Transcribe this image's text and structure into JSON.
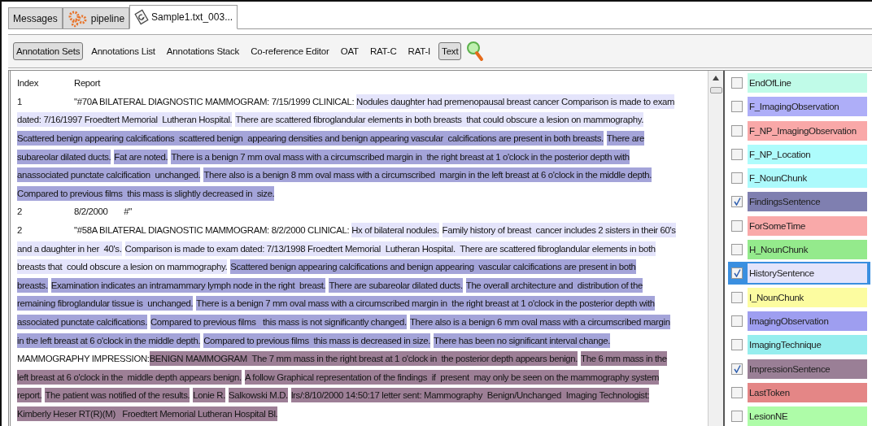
{
  "tabs": [
    {
      "label": "Messages",
      "selected": false
    },
    {
      "label": "pipeline",
      "selected": false
    },
    {
      "label": "Sample1.txt_003...",
      "selected": true
    }
  ],
  "toolbar": [
    {
      "label": "Annotation Sets",
      "selected": true
    },
    {
      "label": "Annotations List",
      "selected": false
    },
    {
      "label": "Annotations Stack",
      "selected": false
    },
    {
      "label": "Co-reference Editor",
      "selected": false
    },
    {
      "label": "OAT",
      "selected": false
    },
    {
      "label": "RAT-C",
      "selected": false
    },
    {
      "label": "RAT-I",
      "selected": false
    },
    {
      "label": "Text",
      "selected": true
    }
  ],
  "document": {
    "header": {
      "index": "Index",
      "report": "Report"
    },
    "lines": [
      {
        "index": "1",
        "segments": [
          {
            "text": "\"#70A BILATERAL DIAGNOSTIC MAMMOGRAM: 7/15/1999 CLINICAL: ",
            "kind": "none"
          },
          {
            "text": "Nodules daughter had premenopausal breast cancer Comparison is made to exam",
            "kind": "history"
          }
        ]
      },
      {
        "segments": [
          {
            "text": "dated: 7/16/1997 Froedtert Memorial  Lutheran Hospital.",
            "kind": "history"
          },
          {
            "text": "There are scattered fibroglandular elements in both breasts  that could obscure a lesion on mammography.",
            "kind": "history"
          }
        ]
      },
      {
        "segments": [
          {
            "text": "Scattered benign appearing calcifications  scattered benign  appearing densities and benign appearing vascular  calcifications are present in both breasts.",
            "kind": "findings"
          },
          {
            "text": "There are",
            "kind": "findings"
          }
        ]
      },
      {
        "segments": [
          {
            "text": "subareolar dilated ducts.",
            "kind": "findings"
          },
          {
            "text": "Fat are noted.",
            "kind": "findings"
          },
          {
            "text": "There is a benign 7 mm oval mass with a circumscribed margin in  the right breast at 1 o'clock in the posterior depth with",
            "kind": "findings"
          }
        ]
      },
      {
        "segments": [
          {
            "text": "anassociated punctate calcification  unchanged.",
            "kind": "findings"
          },
          {
            "text": "There also is a benign 8 mm oval mass with a circumscribed  margin in the left breast at 6 o'clock in the middle depth.",
            "kind": "findings"
          }
        ]
      },
      {
        "segments": [
          {
            "text": "Compared to previous films  this mass is slightly decreased in  size.",
            "kind": "findings"
          }
        ]
      },
      {
        "index": "2",
        "segments": [
          {
            "text": "8/2/2000       #\"",
            "kind": "none"
          }
        ]
      },
      {
        "index": "2",
        "segments": [
          {
            "text": "\"#58A BILATERAL DIAGNOSTIC MAMMOGRAM: 8/2/2000 CLINICAL: ",
            "kind": "none"
          },
          {
            "text": "Hx of bilateral nodules.",
            "kind": "history"
          },
          {
            "text": "Family history of breast  cancer includes 2 sisters in their 60's",
            "kind": "history"
          }
        ]
      },
      {
        "segments": [
          {
            "text": "and a daughter in her  40's.",
            "kind": "history"
          },
          {
            "text": "Comparison is made to exam dated: 7/13/1998 Froedtert Memorial  Lutheran Hospital.  There are scattered fibroglandular elements in both",
            "kind": "history"
          }
        ]
      },
      {
        "segments": [
          {
            "text": "breasts that  could obscure a lesion on mammography.",
            "kind": "history"
          },
          {
            "text": "Scattered benign appearing calcifications and benign appearing  vascular calcifications are present in both",
            "kind": "findings"
          }
        ]
      },
      {
        "segments": [
          {
            "text": "breasts.",
            "kind": "findings"
          },
          {
            "text": "Examination indicates an intramammary lymph node in the right  breast.",
            "kind": "findings"
          },
          {
            "text": "There are subareolar dilated ducts.",
            "kind": "findings"
          },
          {
            "text": "The overall architecture and  distribution of the",
            "kind": "findings"
          }
        ]
      },
      {
        "segments": [
          {
            "text": "remaining fibroglandular tissue is  unchanged.",
            "kind": "findings"
          },
          {
            "text": "There is a benign 7 mm oval mass with a circumscribed margin in  the right breast at 1 o'clock in the posterior depth with",
            "kind": "findings"
          }
        ]
      },
      {
        "segments": [
          {
            "text": "associated punctate calcifications.",
            "kind": "findings"
          },
          {
            "text": "Compared to previous films   this mass is not significantly changed.",
            "kind": "findings"
          },
          {
            "text": "There also is a benign 6 mm oval mass with a circumscribed margin",
            "kind": "findings"
          }
        ]
      },
      {
        "segments": [
          {
            "text": "in the left breast at 6 o'clock in the middle depth.",
            "kind": "findings"
          },
          {
            "text": "Compared to previous films  this mass is decreased in size.",
            "kind": "findings"
          },
          {
            "text": "There has been no significant interval change.",
            "kind": "findings"
          }
        ]
      },
      {
        "segments": [
          {
            "text": "MAMMOGRAPHY IMPRESSION:",
            "kind": "none"
          },
          {
            "text": "BENIGN MAMMOGRAM  The 7 mm mass in the right breast at 1 o'clock in  the posterior depth appears benign.",
            "kind": "impression"
          },
          {
            "text": "The 6 mm mass in the",
            "kind": "impression"
          }
        ]
      },
      {
        "segments": [
          {
            "text": "left breast at 6 o'clock in the  middle depth appears benign.",
            "kind": "impression"
          },
          {
            "text": "A follow Graphical representation of the findings  if  present  may only be seen on the mammography system",
            "kind": "impression"
          }
        ]
      },
      {
        "segments": [
          {
            "text": "report.",
            "kind": "impression"
          },
          {
            "text": "The patient was notified of the results.",
            "kind": "impression"
          },
          {
            "text": "Lonie R.",
            "kind": "impression"
          },
          {
            "text": "Salkowski M.D.",
            "kind": "impression"
          },
          {
            "text": "lrs/:8/10/2000 14:50:17 letter sent: Mammography  Benign/Unchanged  Imaging Technologist:",
            "kind": "impression"
          }
        ]
      },
      {
        "segments": [
          {
            "text": "Kimberly Heser RT(R)(M)   Froedtert Memorial Lutheran Hospital Bl.",
            "kind": "impression"
          }
        ]
      }
    ]
  },
  "annotation_types": [
    {
      "name": "EndOfLine",
      "checked": false,
      "selected": false,
      "color": "#c0fbe8"
    },
    {
      "name": "F_ImagingObservation",
      "checked": false,
      "selected": false,
      "color": "#aeaef8"
    },
    {
      "name": "F_NP_ImagingObservation",
      "checked": false,
      "selected": false,
      "color": "#f9a8a8"
    },
    {
      "name": "F_NP_Location",
      "checked": false,
      "selected": false,
      "color": "#aefcfc"
    },
    {
      "name": "F_NounChunk",
      "checked": false,
      "selected": false,
      "color": "#acfafc"
    },
    {
      "name": "FindingsSentence",
      "checked": true,
      "selected": false,
      "color": "#7f7fb0"
    },
    {
      "name": "ForSomeTime",
      "checked": false,
      "selected": false,
      "color": "#f9a9a9"
    },
    {
      "name": "H_NounChunk",
      "checked": false,
      "selected": false,
      "color": "#94ea8c"
    },
    {
      "name": "HistorySentence",
      "checked": true,
      "selected": true,
      "color": "#e4e4fb"
    },
    {
      "name": "I_NounChunk",
      "checked": false,
      "selected": false,
      "color": "#fcfca0"
    },
    {
      "name": "ImagingObservation",
      "checked": false,
      "selected": false,
      "color": "#9e9ef0"
    },
    {
      "name": "ImagingTechnique",
      "checked": false,
      "selected": false,
      "color": "#96eeee"
    },
    {
      "name": "ImpressionSentence",
      "checked": true,
      "selected": false,
      "color": "#9a7f96"
    },
    {
      "name": "LastToken",
      "checked": false,
      "selected": false,
      "color": "#e48686"
    },
    {
      "name": "LesionNE",
      "checked": false,
      "selected": false,
      "color": "#aefca8"
    }
  ]
}
